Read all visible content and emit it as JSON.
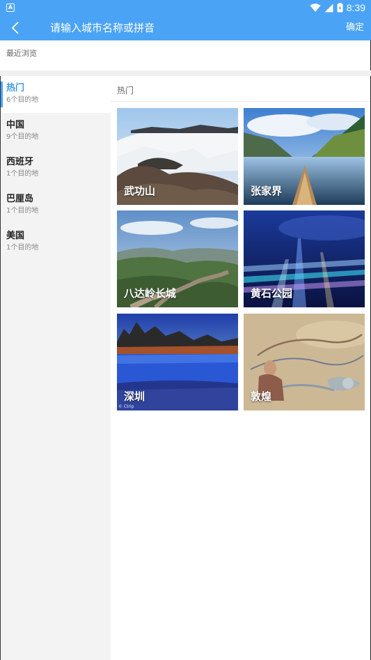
{
  "status_bar": {
    "time": "8:39",
    "app_icon_letter": "A"
  },
  "header": {
    "title": "请输入城市名称或拼音",
    "confirm_label": "确定"
  },
  "recent": {
    "label": "最近浏览"
  },
  "sidebar": {
    "items": [
      {
        "name": "热门",
        "count": "6个目的地",
        "active": true
      },
      {
        "name": "中国",
        "count": "9个目的地",
        "active": false
      },
      {
        "name": "西班牙",
        "count": "1个目的地",
        "active": false
      },
      {
        "name": "巴厘岛",
        "count": "1个目的地",
        "active": false
      },
      {
        "name": "美国",
        "count": "1个目的地",
        "active": false
      }
    ]
  },
  "main": {
    "section_title": "热门",
    "destinations": [
      {
        "label": "武功山",
        "image": "misty-mountains-photo"
      },
      {
        "label": "张家界",
        "image": "lake-canoe-photo"
      },
      {
        "label": "八达岭长城",
        "image": "great-wall-photo"
      },
      {
        "label": "黄石公园",
        "image": "city-lights-photo"
      },
      {
        "label": "深圳",
        "image": "blue-lake-photo",
        "watermark": "© Ctrip"
      },
      {
        "label": "敦煌",
        "image": "mural-painting-photo"
      }
    ]
  }
}
